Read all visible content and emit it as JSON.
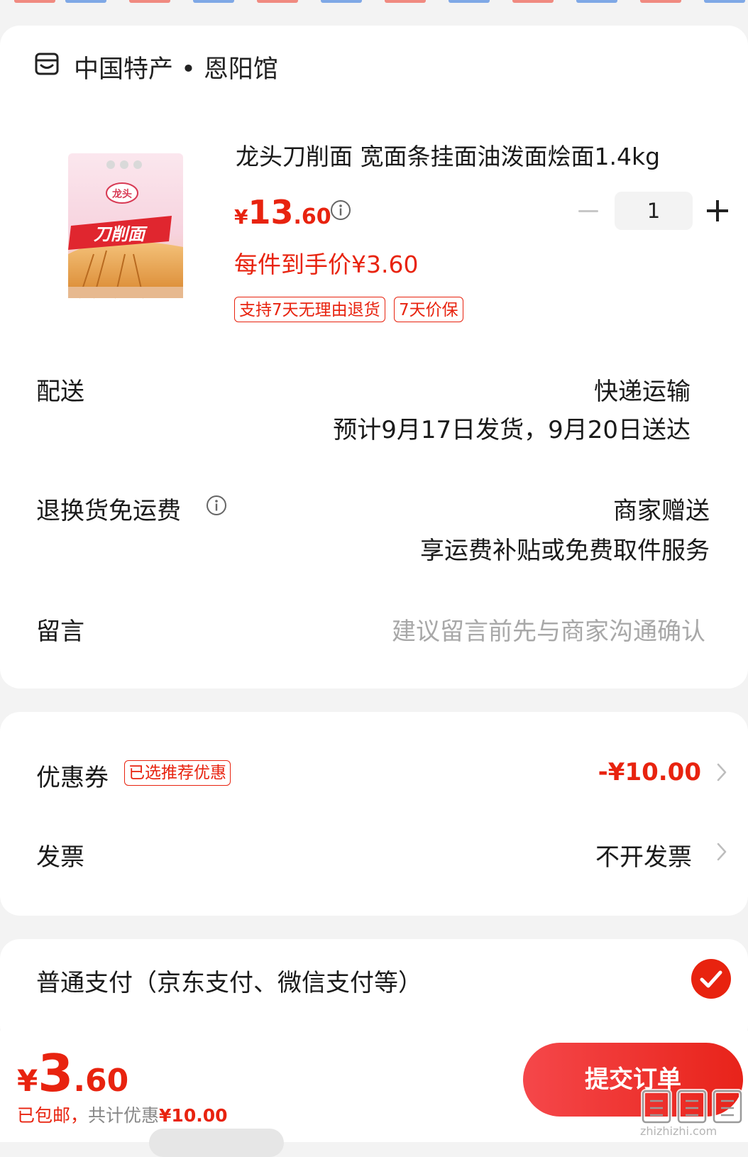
{
  "colors": {
    "accent": "#e8230f",
    "muted": "#a8a8a8",
    "background": "#f3f3f3"
  },
  "store": {
    "icon": "store-icon",
    "name": "中国特产 • 恩阳馆"
  },
  "product": {
    "image_text": "刀削面",
    "title": "龙头刀削面 宽面条挂面油泼面烩面1.4kg",
    "price_currency": "¥",
    "price_integer": "13",
    "price_decimal": ".60",
    "quantity": "1",
    "hand_price": "每件到手价¥3.60",
    "tags": [
      "支持7天无理由退货",
      "7天价保"
    ]
  },
  "delivery": {
    "label": "配送",
    "method": "快递运输",
    "estimate": "预计9月17日发货，9月20日送达"
  },
  "return_shipping": {
    "label": "退换货免运费",
    "value": "商家赠送",
    "desc": "享运费补贴或免费取件服务"
  },
  "message": {
    "label": "留言",
    "placeholder": "建议留言前先与商家沟通确认"
  },
  "coupon": {
    "label": "优惠券",
    "badge": "已选推荐优惠",
    "value": "-¥10.00"
  },
  "invoice": {
    "label": "发票",
    "value": "不开发票"
  },
  "payment": {
    "label": "普通支付（京东支付、微信支付等）",
    "selected": true
  },
  "footer": {
    "total_currency": "¥",
    "total_integer": "3",
    "total_decimal": ".60",
    "shipping": "已包邮，",
    "discount_label": "共计优惠",
    "discount_value": "¥10.00",
    "submit_label": "提交订单"
  },
  "watermark": {
    "text": "zhizhizhi.com"
  }
}
